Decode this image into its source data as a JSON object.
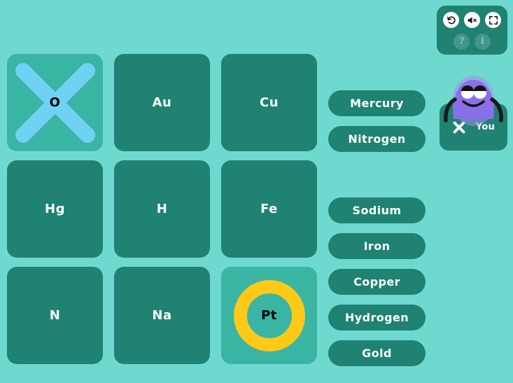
{
  "theme": {
    "background": "#6FD9D0",
    "tile": "#1F8273",
    "tile_marked": "#3AB5A4",
    "mark_x_color": "#6FD2F5",
    "mark_o_color": "#FFC917",
    "avatar_body": "#8A6FE8",
    "text_light": "#FFFFFF",
    "text_dark": "#000000"
  },
  "controls": {
    "restart": {
      "name": "restart-icon",
      "label": "Restart"
    },
    "sound": {
      "name": "sound-muted-icon",
      "label": "Sound off"
    },
    "fullscreen": {
      "name": "fullscreen-icon",
      "label": "Fullscreen"
    },
    "help": {
      "name": "help-icon",
      "label": "?"
    },
    "info": {
      "name": "info-icon",
      "label": "i"
    }
  },
  "player": {
    "mark": "X",
    "name": "You"
  },
  "grid": {
    "columns": 3,
    "rows": 3,
    "tiles": [
      {
        "symbol": "O",
        "mark": "X",
        "row": 0,
        "col": 0
      },
      {
        "symbol": "Au",
        "mark": "none",
        "row": 0,
        "col": 1
      },
      {
        "symbol": "Cu",
        "mark": "none",
        "row": 0,
        "col": 2
      },
      {
        "symbol": "Hg",
        "mark": "none",
        "row": 1,
        "col": 0
      },
      {
        "symbol": "H",
        "mark": "none",
        "row": 1,
        "col": 1
      },
      {
        "symbol": "Fe",
        "mark": "none",
        "row": 1,
        "col": 2
      },
      {
        "symbol": "N",
        "mark": "none",
        "row": 2,
        "col": 0
      },
      {
        "symbol": "Na",
        "mark": "none",
        "row": 2,
        "col": 1
      },
      {
        "symbol": "Pt",
        "mark": "O",
        "row": 2,
        "col": 2
      }
    ]
  },
  "answers": [
    {
      "label": "Mercury",
      "slot": 0
    },
    {
      "label": "Nitrogen",
      "slot": 1
    },
    {
      "label": "Sodium",
      "slot": 3
    },
    {
      "label": "Iron",
      "slot": 4
    },
    {
      "label": "Copper",
      "slot": 5
    },
    {
      "label": "Hydrogen",
      "slot": 6
    },
    {
      "label": "Gold",
      "slot": 7
    }
  ]
}
